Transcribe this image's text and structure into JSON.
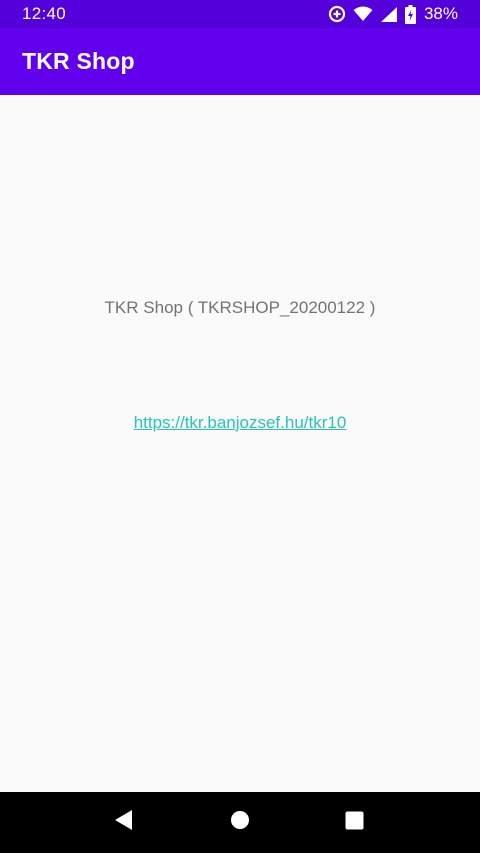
{
  "status_bar": {
    "time": "12:40",
    "battery_percent": "38%",
    "icons": [
      "data-saver-icon",
      "wifi-icon",
      "cell-signal-icon",
      "battery-charging-icon"
    ]
  },
  "app_bar": {
    "title": "TKR Shop"
  },
  "main": {
    "version_text": "TKR Shop ( TKRSHOP_20200122 )",
    "link_text": "https://tkr.banjozsef.hu/tkr10"
  },
  "nav_bar": {
    "icons": [
      "back-icon",
      "home-icon",
      "recents-icon"
    ]
  },
  "colors": {
    "status_bar": "#5300db",
    "app_bar": "#6200ee",
    "background": "#fafafa",
    "text_gray": "#737373",
    "link": "#26c6b5"
  }
}
